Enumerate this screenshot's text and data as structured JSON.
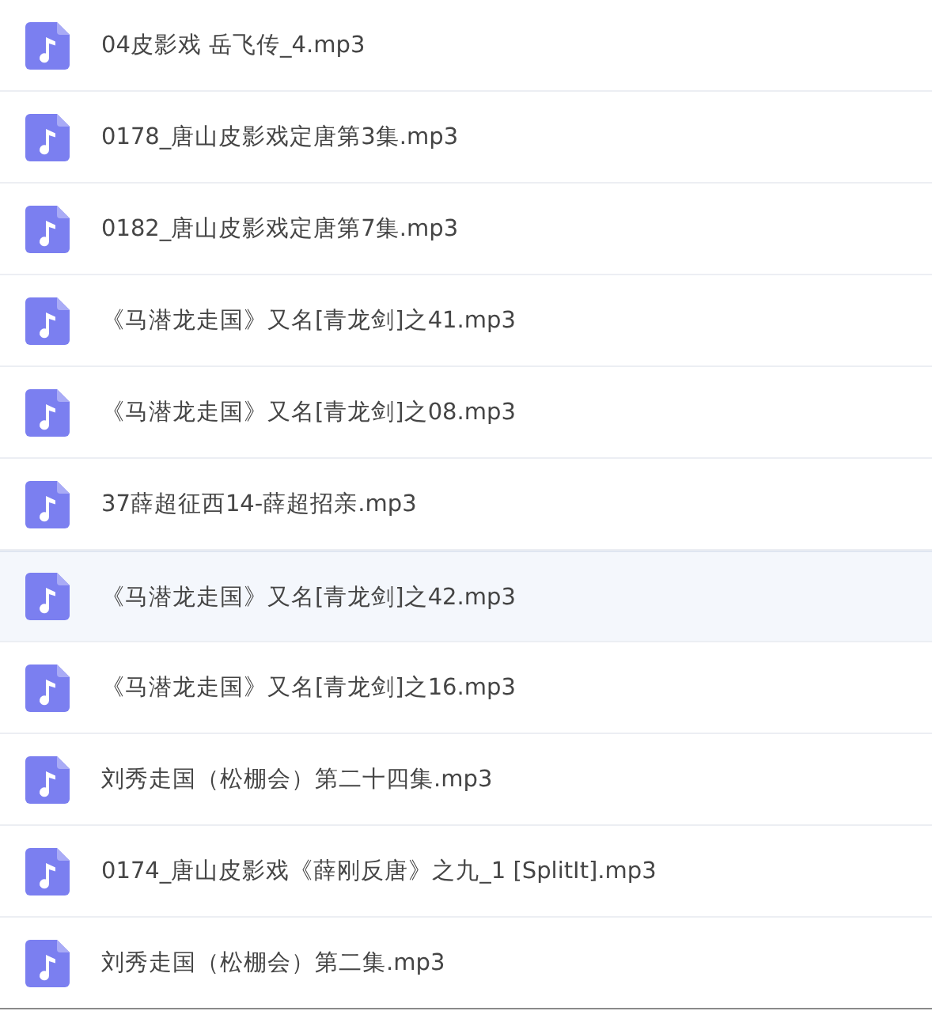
{
  "files": [
    {
      "name": "04皮影戏 岳飞传_4.mp3",
      "selected": false
    },
    {
      "name": "0178_唐山皮影戏定唐第3集.mp3",
      "selected": false
    },
    {
      "name": "0182_唐山皮影戏定唐第7集.mp3",
      "selected": false
    },
    {
      "name": "《马潜龙走国》又名[青龙剑]之41.mp3",
      "selected": false
    },
    {
      "name": "《马潜龙走国》又名[青龙剑]之08.mp3",
      "selected": false
    },
    {
      "name": "37薛超征西14-薛超招亲.mp3",
      "selected": false
    },
    {
      "name": "《马潜龙走国》又名[青龙剑]之42.mp3",
      "selected": true
    },
    {
      "name": "《马潜龙走国》又名[青龙剑]之16.mp3",
      "selected": false
    },
    {
      "name": "刘秀走国（松棚会）第二十四集.mp3",
      "selected": false
    },
    {
      "name": "0174_唐山皮影戏《薛刚反唐》之九_1 [SplitIt].mp3",
      "selected": false
    },
    {
      "name": "刘秀走国（松棚会）第二集.mp3",
      "selected": false
    }
  ]
}
